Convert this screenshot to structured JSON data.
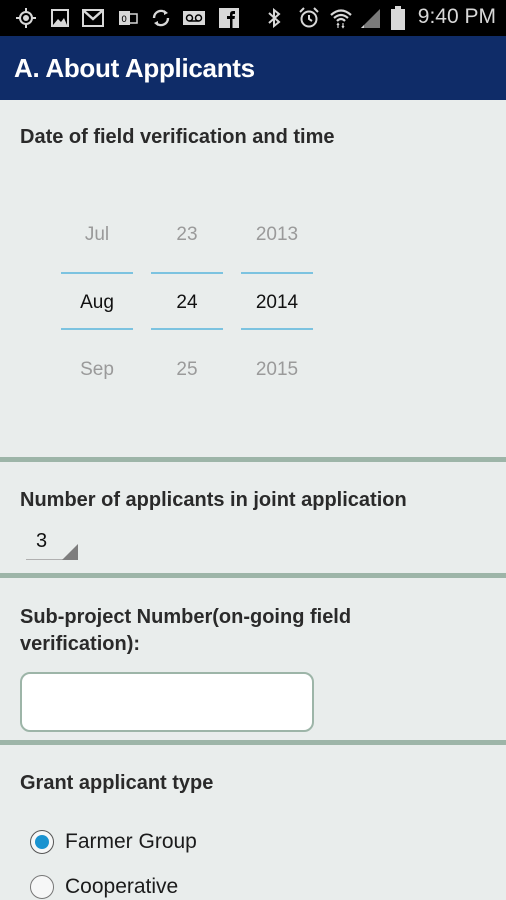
{
  "status_bar": {
    "left_icons": [
      "location-icon",
      "image-icon",
      "gmail-icon",
      "outlook-icon",
      "sync-icon",
      "voicemail-icon",
      "facebook-icon"
    ],
    "right_icons": [
      "bluetooth-icon",
      "alarm-icon",
      "wifi-icon",
      "signal-icon",
      "battery-icon"
    ],
    "time": "9:40 PM"
  },
  "app_bar": {
    "title": "A. About Applicants"
  },
  "date_section": {
    "label": "Date of field verification and time",
    "month": {
      "prev": "Jul",
      "selected": "Aug",
      "next": "Sep"
    },
    "day": {
      "prev": "23",
      "selected": "24",
      "next": "25"
    },
    "year": {
      "prev": "2013",
      "selected": "2014",
      "next": "2015"
    },
    "accent_color": "#7cc3e0"
  },
  "applicants_section": {
    "label": "Number of applicants in joint application",
    "selected_value": "3"
  },
  "subproject_section": {
    "label_line1": "Sub-project Number(on-going field",
    "label_line2": "verification):",
    "value": "",
    "placeholder": ""
  },
  "grant_type_section": {
    "label": "Grant applicant type",
    "options": [
      {
        "label": "Farmer Group",
        "checked": true
      },
      {
        "label": "Cooperative",
        "checked": false
      }
    ],
    "accent_color": "#1a93d0"
  },
  "colors": {
    "app_bar": "#0f2c68",
    "divider": "#9db5a8",
    "background": "#e9edec"
  }
}
